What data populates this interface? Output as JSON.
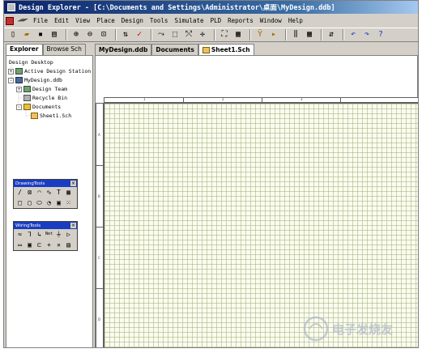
{
  "window": {
    "title": "Design Explorer - [C:\\Documents and Settings\\Administrator\\桌面\\MyDesign.ddb]"
  },
  "menu": [
    "File",
    "Edit",
    "View",
    "Place",
    "Design",
    "Tools",
    "Simulate",
    "PLD",
    "Reports",
    "Window",
    "Help"
  ],
  "toolbar": {
    "icons": [
      "toggle-panel-icon",
      "open-icon",
      "save-icon",
      "print-icon",
      "zoom-in-icon",
      "zoom-out-icon",
      "zoom-fit-icon",
      "cross-probe-icon",
      "wire-icon",
      "bus-icon",
      "rectangle-select-icon",
      "move-icon",
      "library-icon",
      "browse-library-icon",
      "hierarchy-icon",
      "component-icon",
      "part-icon",
      "undo-icon",
      "redo-icon",
      "help-icon"
    ]
  },
  "left_panel": {
    "tabs": [
      "Explorer",
      "Browse Sch"
    ],
    "tree": [
      {
        "label": "Design Desktop",
        "level": 0,
        "expand": "",
        "icon": "desktop"
      },
      {
        "label": "Active Design Station",
        "level": 1,
        "expand": "+",
        "icon": "net"
      },
      {
        "label": "MyDesign.ddb",
        "level": 1,
        "expand": "-",
        "icon": "db"
      },
      {
        "label": "Design Team",
        "level": 2,
        "expand": "+",
        "icon": "net"
      },
      {
        "label": "Recycle Bin",
        "level": 2,
        "expand": "",
        "icon": "trash"
      },
      {
        "label": "Documents",
        "level": 2,
        "expand": "-",
        "icon": "folder"
      },
      {
        "label": "Sheet1.Sch",
        "level": 3,
        "expand": "",
        "icon": "sheet"
      }
    ]
  },
  "drawing_tools": {
    "title": "DrawingTools",
    "row1": [
      "/",
      "⊠",
      "◠",
      "∿",
      "T",
      "▦"
    ],
    "row2": [
      "□",
      "▢",
      "⬭",
      "◔",
      "▣",
      "⁙"
    ]
  },
  "wiring_tools": {
    "title": "WiringTools",
    "row1": [
      "≈",
      "⅂",
      "↳",
      "Net",
      "⏚",
      "▷"
    ],
    "row2": [
      "▭",
      "▣",
      "⊏",
      "+",
      "✕",
      "▤"
    ]
  },
  "doc_tabs": [
    "MyDesign.ddb",
    "Documents",
    "Sheet1.Sch"
  ],
  "sheet": {
    "top_zones": [
      "1",
      "2",
      "3"
    ],
    "left_zones": [
      "A",
      "B",
      "C",
      "D"
    ]
  },
  "watermark": "电子发烧友"
}
